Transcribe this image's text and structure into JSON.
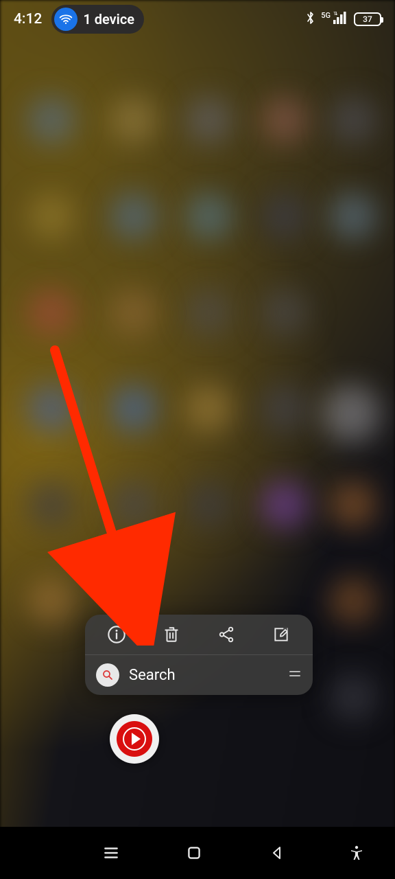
{
  "status": {
    "clock": "4:12",
    "device_chip_text": "1 device",
    "network_label": "5G",
    "battery_percent": "37"
  },
  "popup": {
    "actions": {
      "info": "info-icon",
      "delete": "trash-icon",
      "share": "share-icon",
      "edit": "edit-icon"
    },
    "search_label": "Search"
  },
  "colors": {
    "accent_blue": "#1a73e8",
    "annotation_red": "#ff2a00",
    "app_red": "#d90f0f"
  }
}
